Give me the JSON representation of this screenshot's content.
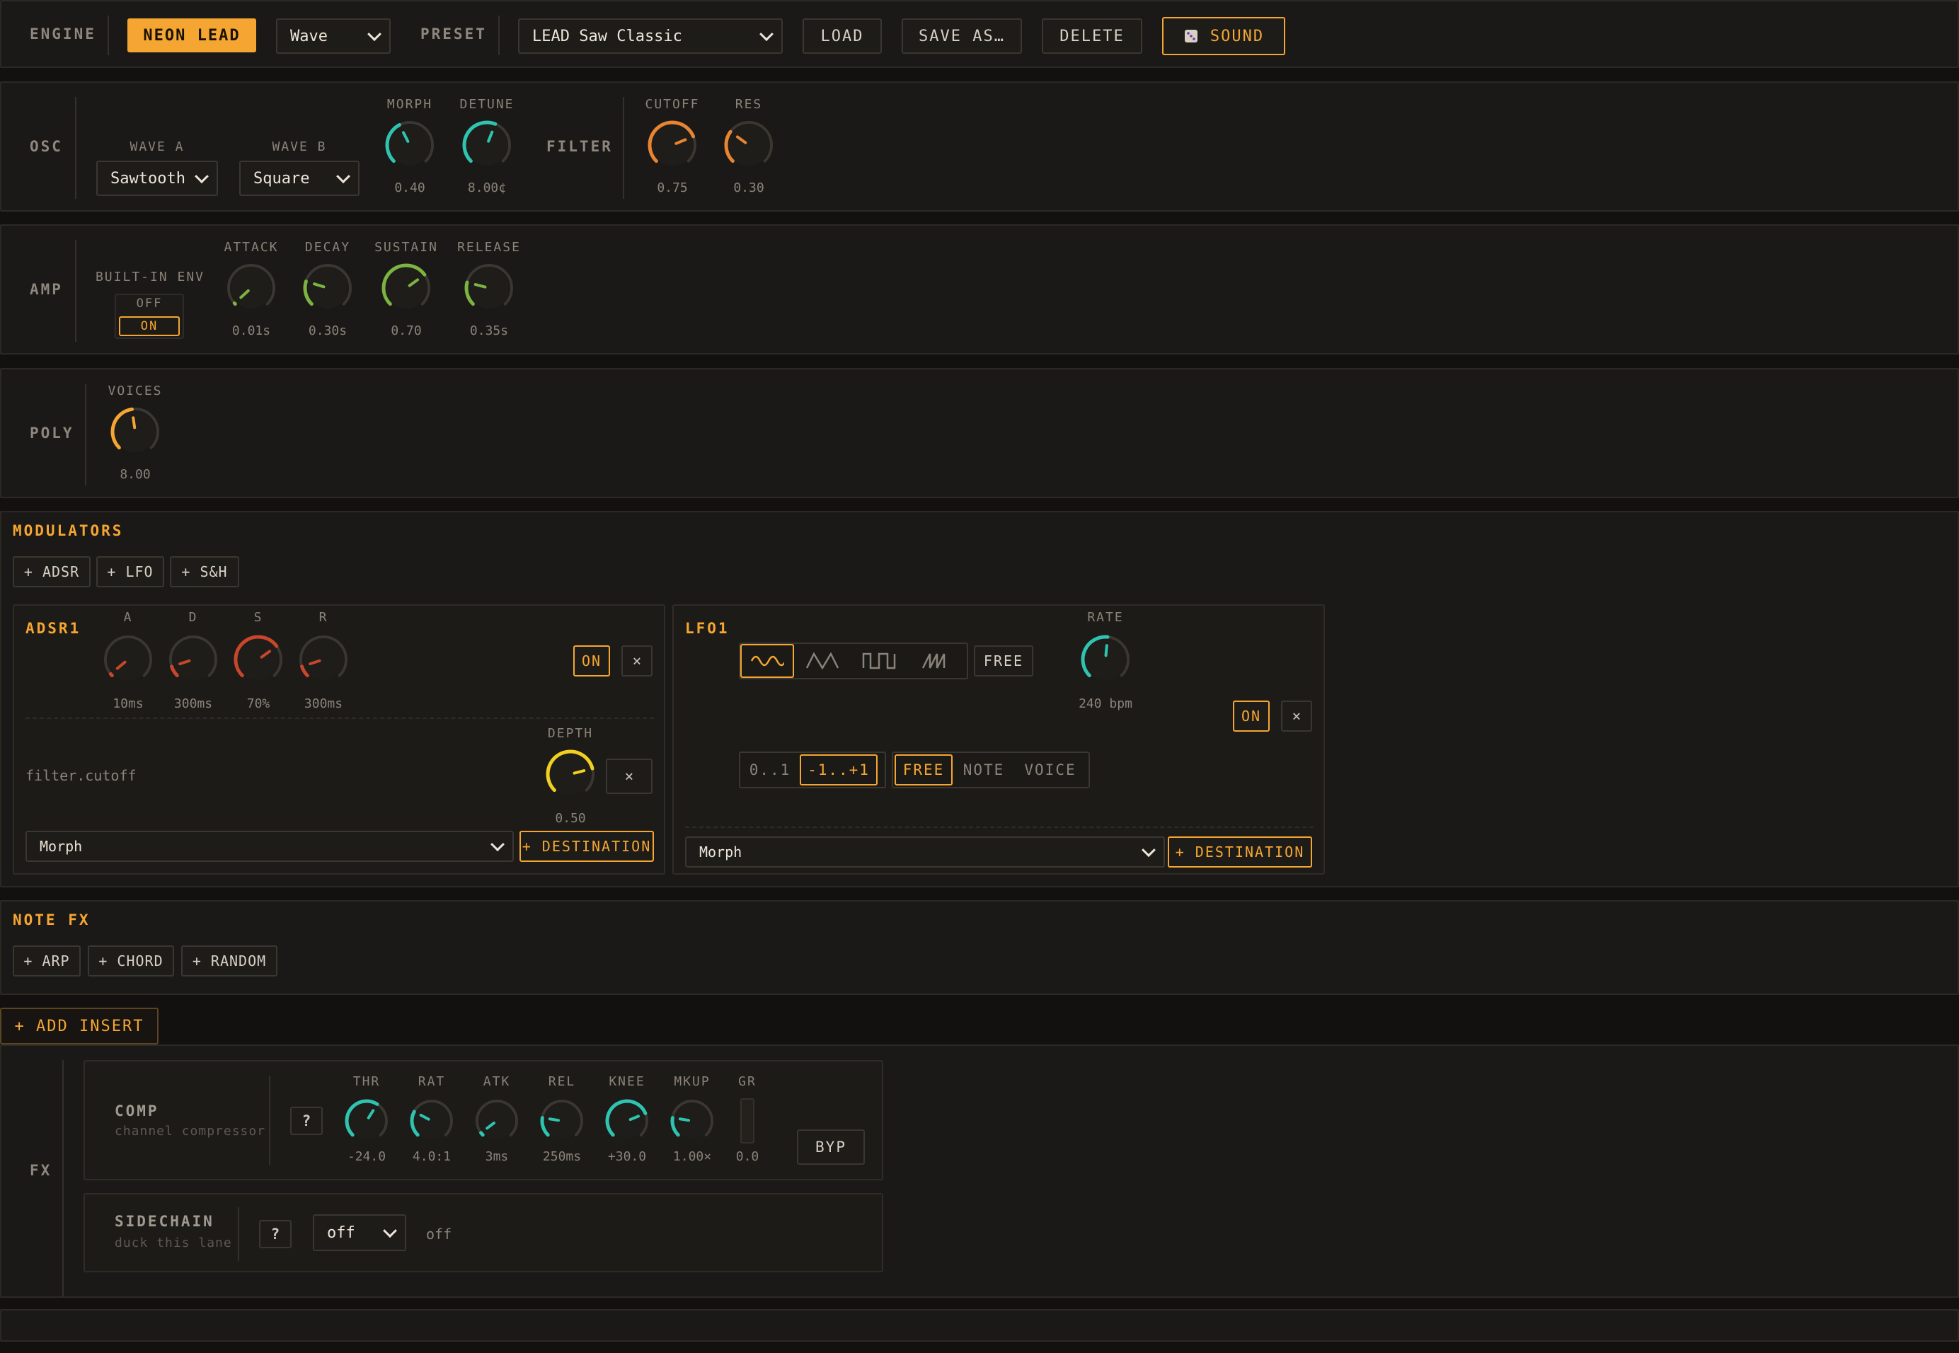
{
  "colors": {
    "accent": "#f5a632",
    "teal": "#2ec4b0",
    "orange": "#e88532",
    "green": "#7db343",
    "red": "#c8462b",
    "yellow": "#f0d020",
    "track": "#3a3631"
  },
  "header": {
    "engine_label": "ENGINE",
    "engine_name": "NEON LEAD",
    "engine_select": "Wave",
    "preset_label": "PRESET",
    "preset_select": "LEAD Saw Classic",
    "load": "LOAD",
    "save_as": "SAVE AS…",
    "delete": "DELETE",
    "sound": "SOUND",
    "sound_icon": "dice-icon"
  },
  "osc": {
    "label": "OSC",
    "wave_a_label": "WAVE A",
    "wave_a": "Sawtooth",
    "wave_b_label": "WAVE B",
    "wave_b": "Square",
    "morph_label": "MORPH",
    "morph_value": "0.40",
    "morph_level": 0.4,
    "detune_label": "DETUNE",
    "detune_value": "8.00¢",
    "detune_level": 0.58
  },
  "filter": {
    "label": "FILTER",
    "cutoff_label": "CUTOFF",
    "cutoff_value": "0.75",
    "cutoff_level": 0.75,
    "res_label": "RES",
    "res_value": "0.30",
    "res_level": 0.3
  },
  "amp": {
    "label": "AMP",
    "env_label": "BUILT-IN ENV",
    "off": "OFF",
    "on": "ON",
    "attack_label": "ATTACK",
    "attack_value": "0.01s",
    "attack_level": 0.01,
    "decay_label": "DECAY",
    "decay_value": "0.30s",
    "decay_level": 0.23,
    "sustain_label": "SUSTAIN",
    "sustain_value": "0.70",
    "sustain_level": 0.7,
    "release_label": "RELEASE",
    "release_value": "0.35s",
    "release_level": 0.22
  },
  "poly": {
    "label": "POLY",
    "voices_label": "VOICES",
    "voices_value": "8.00",
    "voices_level": 0.47
  },
  "modulators": {
    "title": "MODULATORS",
    "add_adsr": "+ ADSR",
    "add_lfo": "+ LFO",
    "add_sh": "+ S&H",
    "adsr1": {
      "title": "ADSR1",
      "a_label": "A",
      "a_value": "10ms",
      "a_level": 0.02,
      "d_label": "D",
      "d_value": "300ms",
      "d_level": 0.1,
      "s_label": "S",
      "s_value": "70%",
      "s_level": 0.7,
      "r_label": "R",
      "r_value": "300ms",
      "r_level": 0.1,
      "on": "ON",
      "close": "×",
      "depth_label": "DEPTH",
      "depth_value": "0.50",
      "depth_level": 0.78,
      "route_target": "filter.cutoff",
      "route_close": "×",
      "dest_select": "Morph",
      "add_dest": "+ DESTINATION"
    },
    "lfo1": {
      "title": "LFO1",
      "shapes": [
        "sine-wave-icon",
        "triangle-wave-icon",
        "square-wave-icon",
        "saw-wave-icon"
      ],
      "sync": "FREE",
      "rate_label": "RATE",
      "rate_value": "240 bpm",
      "rate_level": 0.52,
      "on": "ON",
      "close": "×",
      "range_uni": "0..1",
      "range_bi": "-1..+1",
      "mode_free": "FREE",
      "mode_note": "NOTE",
      "mode_voice": "VOICE",
      "dest_select": "Morph",
      "add_dest": "+ DESTINATION"
    }
  },
  "notefx": {
    "title": "NOTE FX",
    "add_arp": "+ ARP",
    "add_chord": "+ CHORD",
    "add_random": "+ RANDOM"
  },
  "fx": {
    "add_insert": "+ ADD INSERT",
    "label": "FX",
    "comp": {
      "name": "COMP",
      "desc": "channel compressor",
      "help": "?",
      "thr_label": "THR",
      "thr_value": "-24.0",
      "thr_level": 0.62,
      "rat_label": "RAT",
      "rat_value": "4.0:1",
      "rat_level": 0.27,
      "atk_label": "ATK",
      "atk_value": "3ms",
      "atk_level": 0.03,
      "rel_label": "REL",
      "rel_value": "250ms",
      "rel_level": 0.2,
      "knee_label": "KNEE",
      "knee_value": "+30.0",
      "knee_level": 0.75,
      "mkup_label": "MKUP",
      "mkup_value": "1.00×",
      "mkup_level": 0.2,
      "gr_label": "GR",
      "gr_value": "0.0",
      "byp": "BYP"
    },
    "sidechain": {
      "name": "SIDECHAIN",
      "desc": "duck this lane",
      "help": "?",
      "select": "off",
      "status": "off"
    }
  }
}
